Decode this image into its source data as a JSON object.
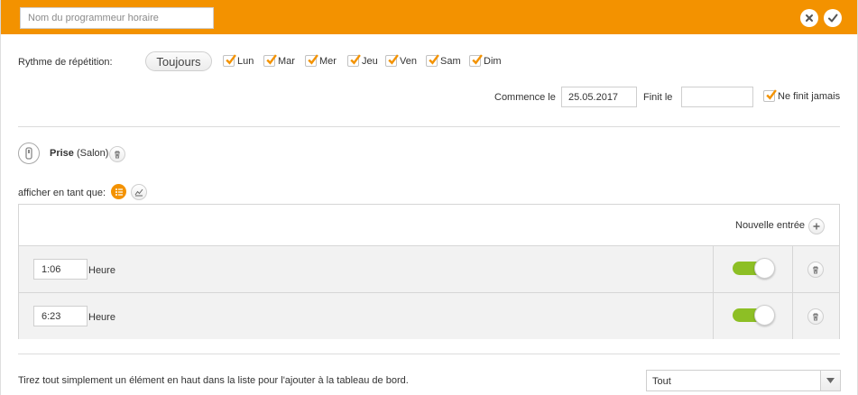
{
  "header": {
    "name_placeholder": "Nom du programmeur horaire",
    "name_value": "",
    "close_icon": "close-icon",
    "confirm_icon": "check-icon",
    "accent_color": "#f39200"
  },
  "repeat": {
    "label": "Rythme de répétition:",
    "always_label": "Toujours",
    "days": [
      {
        "label": "Lun",
        "checked": true
      },
      {
        "label": "Mar",
        "checked": true
      },
      {
        "label": "Mer",
        "checked": true
      },
      {
        "label": "Jeu",
        "checked": true
      },
      {
        "label": "Ven",
        "checked": true
      },
      {
        "label": "Sam",
        "checked": true
      },
      {
        "label": "Dim",
        "checked": true
      }
    ]
  },
  "dates": {
    "start_label": "Commence le",
    "start_value": "25.05.2017",
    "end_label": "Finit le",
    "end_value": "",
    "never_label": "Ne finit jamais",
    "never_checked": true
  },
  "device": {
    "name": "Prise",
    "room": "(Salon)",
    "icon": "plug-icon",
    "delete_icon": "trash-icon"
  },
  "display": {
    "label": "afficher en tant que:",
    "list_icon": "list-icon",
    "chart_icon": "chart-icon"
  },
  "entries": {
    "new_label": "Nouvelle entrée",
    "add_icon": "plus-icon",
    "rows": [
      {
        "time": "1:06",
        "unit": "Heure",
        "enabled": true
      },
      {
        "time": "6:23",
        "unit": "Heure",
        "enabled": true
      }
    ],
    "toggle_color": "#8dbf25"
  },
  "footer": {
    "hint": "Tirez tout simplement un élément en haut dans la liste pour l'ajouter à la tableau de bord.",
    "filter_value": "Tout"
  }
}
